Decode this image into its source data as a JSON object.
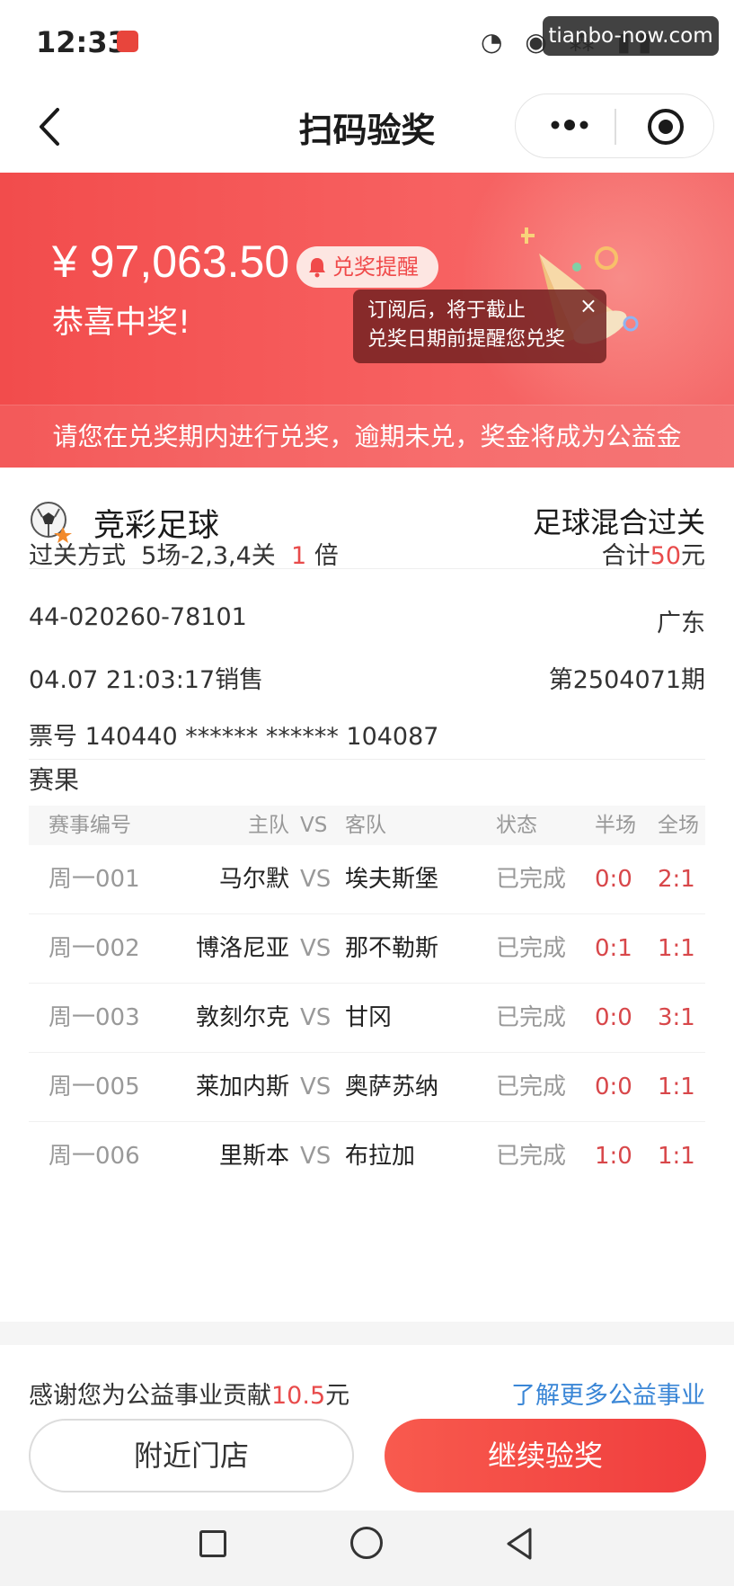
{
  "status_bar": {
    "time": "12:33",
    "icons": "◔ ◉ ⁂ ▮▮",
    "watermark": "tianbo-now.com"
  },
  "header": {
    "title": "扫码验奖",
    "back_icon": "chevron-left-icon",
    "more_icon": "more-dots-icon",
    "target_icon": "target-icon"
  },
  "banner": {
    "amount": "¥ 97,063.50",
    "remind_label": "兑奖提醒",
    "congrats": "恭喜中奖!",
    "tooltip_line1": "订阅后，将于截止",
    "tooltip_line2": "兑奖日期前提醒您兑奖",
    "tooltip_close": "×",
    "notice": "请您在兑奖期内进行兑奖，逾期未兑，奖金将成为公益金"
  },
  "ticket": {
    "game_name": "竞彩足球",
    "game_type": "足球混合过关",
    "pass_label": "过关方式",
    "pass_value": "5场-2,3,4关",
    "multiplier": "1",
    "multiplier_unit": "倍",
    "total_label": "合计",
    "total_amount": "50",
    "total_unit": "元",
    "serial": "44-020260-78101",
    "province": "广东",
    "sale_time": "04.07 21:03:17销售",
    "issue": "第2504071期",
    "ticket_no": "票号 140440 ****** ****** 104087"
  },
  "results": {
    "title": "赛果",
    "headers": {
      "id": "赛事编号",
      "home": "主队",
      "vs": "VS",
      "away": "客队",
      "status": "状态",
      "half": "半场",
      "full": "全场"
    },
    "rows": [
      {
        "id": "周一001",
        "home": "马尔默",
        "vs": "VS",
        "away": "埃夫斯堡",
        "status": "已完成",
        "half": "0:0",
        "full": "2:1"
      },
      {
        "id": "周一002",
        "home": "博洛尼亚",
        "vs": "VS",
        "away": "那不勒斯",
        "status": "已完成",
        "half": "0:1",
        "full": "1:1"
      },
      {
        "id": "周一003",
        "home": "敦刻尔克",
        "vs": "VS",
        "away": "甘冈",
        "status": "已完成",
        "half": "0:0",
        "full": "3:1"
      },
      {
        "id": "周一005",
        "home": "莱加内斯",
        "vs": "VS",
        "away": "奥萨苏纳",
        "status": "已完成",
        "half": "0:0",
        "full": "1:1"
      },
      {
        "id": "周一006",
        "home": "里斯本",
        "vs": "VS",
        "away": "布拉加",
        "status": "已完成",
        "half": "1:0",
        "full": "1:1"
      }
    ]
  },
  "footer": {
    "charity_prefix": "感谢您为公益事业贡献",
    "charity_amount": "10.5",
    "charity_unit": "元",
    "charity_link": "了解更多公益事业",
    "nearby_button": "附近门店",
    "continue_button": "继续验奖"
  },
  "colors": {
    "accent_red": "#f24c4c",
    "link_blue": "#3a86d6",
    "score_red": "#d8474a"
  }
}
